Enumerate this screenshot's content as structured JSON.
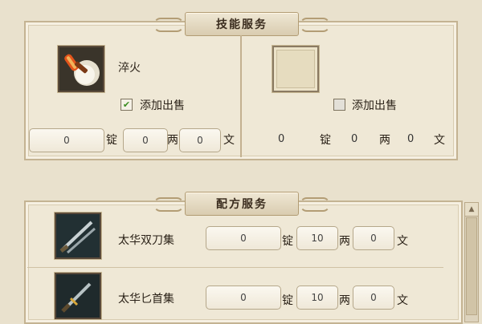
{
  "skill_service": {
    "title": "技能服务",
    "left": {
      "name": "淬火",
      "add_sale_label": "添加出售",
      "add_sale_checked": true,
      "ding": "0",
      "liang": "0",
      "wen": "0"
    },
    "right": {
      "add_sale_label": "添加出售",
      "add_sale_checked": false,
      "ding": "0",
      "liang": "0",
      "wen": "0"
    }
  },
  "recipe_service": {
    "title": "配方服务",
    "items": [
      {
        "name": "太华双刀集",
        "ding": "0",
        "liang": "10",
        "wen": "0"
      },
      {
        "name": "太华匕首集",
        "ding": "0",
        "liang": "10",
        "wen": "0"
      }
    ]
  },
  "currency": {
    "ding": "锭",
    "liang": "两",
    "wen": "文"
  },
  "icons": {
    "left_skill": "quench-fire-icon",
    "right_skill": "empty-slot-icon",
    "recipe_1": "twin-blades-icon",
    "recipe_2": "dagger-icon"
  }
}
